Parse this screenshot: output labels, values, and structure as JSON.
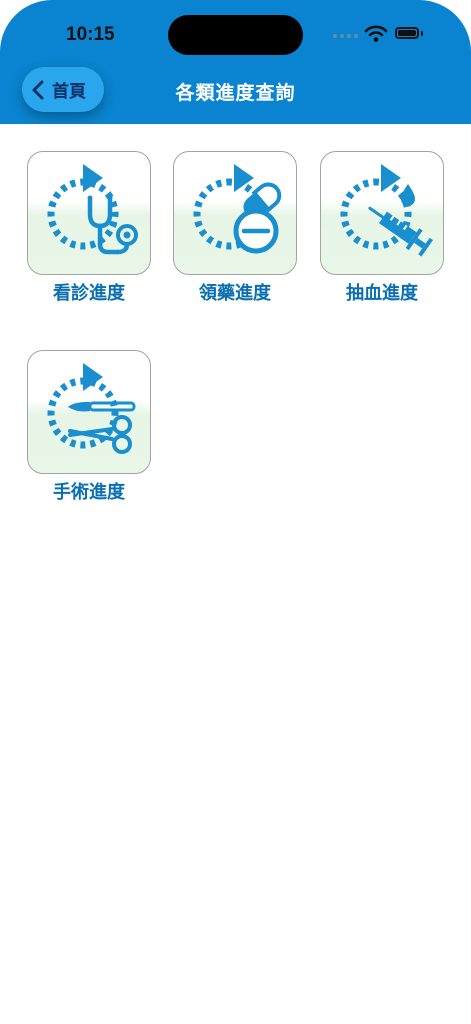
{
  "status_bar": {
    "time": "10:15"
  },
  "nav": {
    "back_label": "首頁",
    "title": "各類進度查詢"
  },
  "items": [
    {
      "label": "看診進度",
      "icon": "stethoscope-icon"
    },
    {
      "label": "領藥進度",
      "icon": "medicine-pill-icon"
    },
    {
      "label": "抽血進度",
      "icon": "syringe-blood-icon"
    },
    {
      "label": "手術進度",
      "icon": "surgery-scissors-icon"
    }
  ],
  "colors": {
    "header": "#0a84d0",
    "accent": "#1a8fcf",
    "label": "#0a6fb0"
  }
}
